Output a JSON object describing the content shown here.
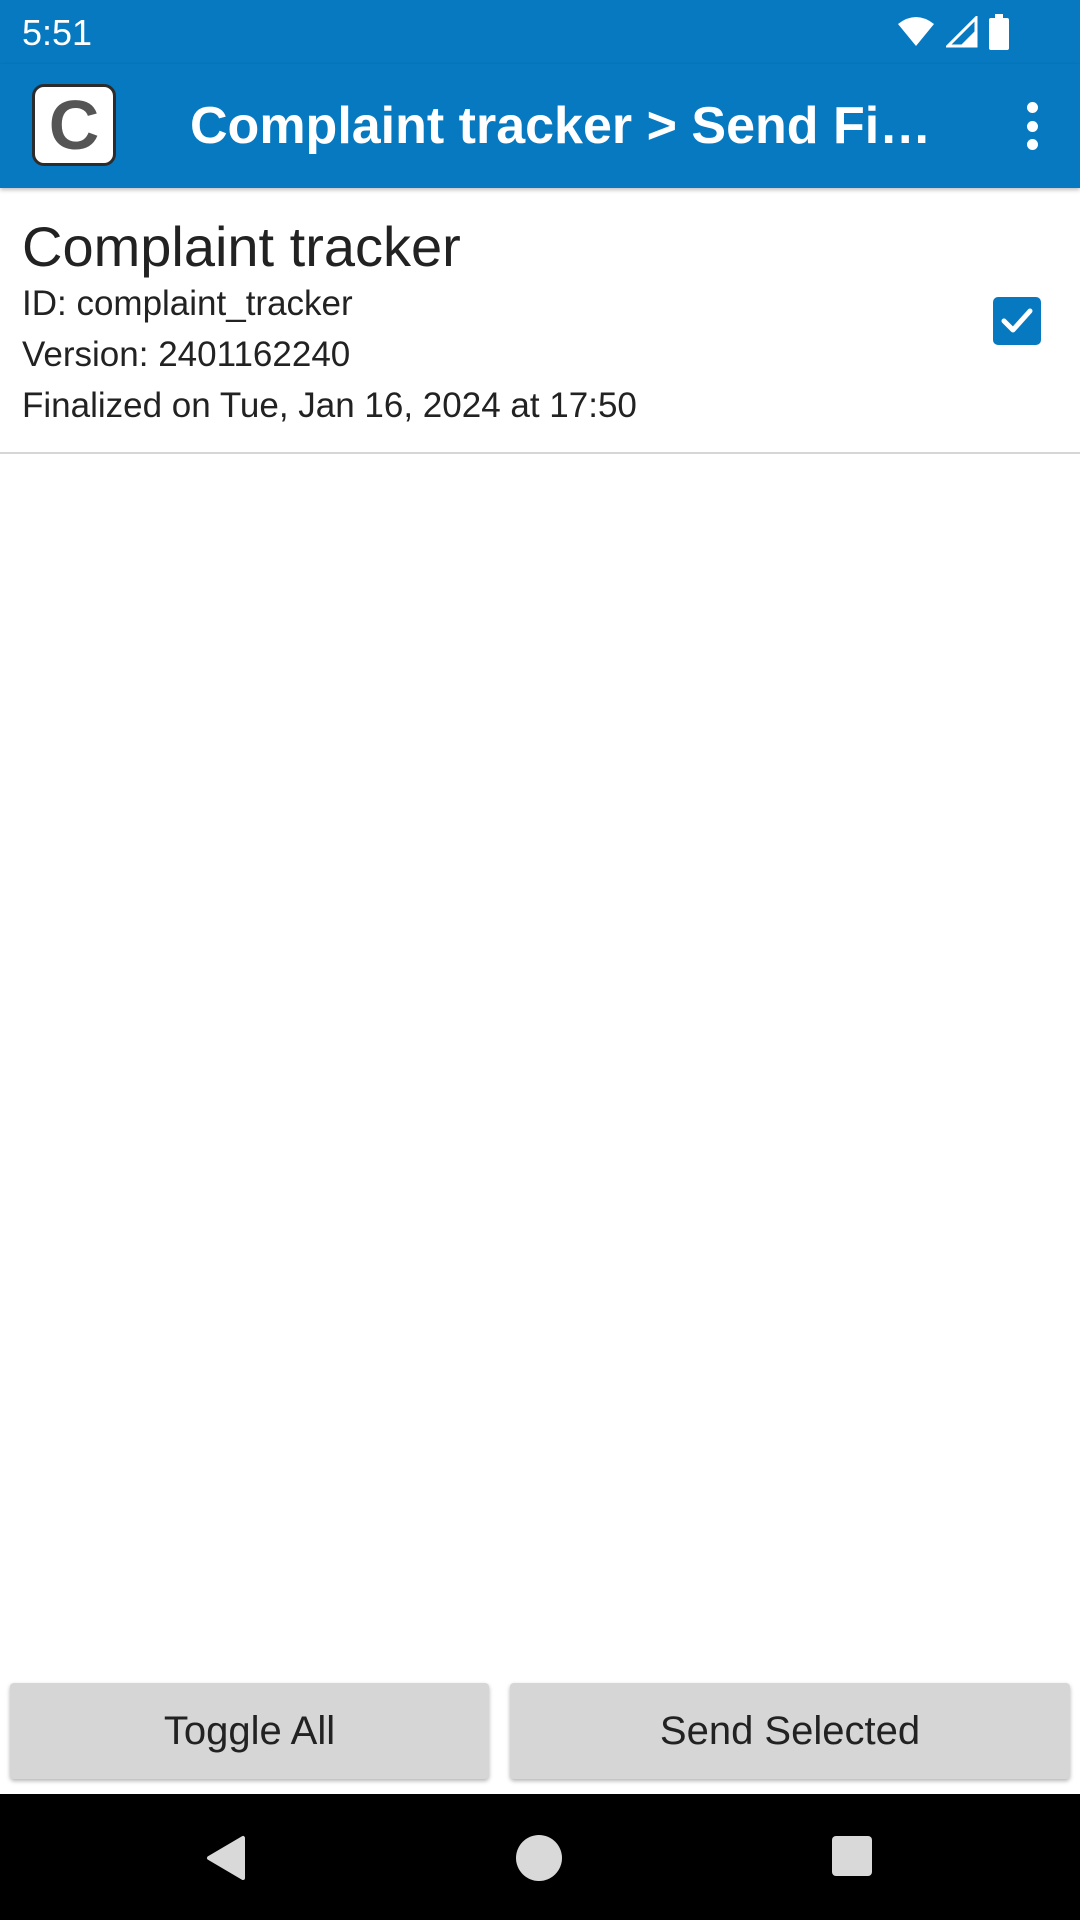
{
  "status_bar": {
    "time": "5:51",
    "icons": [
      "wifi-icon",
      "signal-icon",
      "battery-icon"
    ]
  },
  "app_bar": {
    "logo_letter": "C",
    "title": "Complaint tracker > Send Finalized Forms",
    "menu_icon": "more-vert-icon",
    "color": "#0679c1"
  },
  "list": {
    "items": [
      {
        "title": "Complaint tracker",
        "id_text": "ID: complaint_tracker",
        "version_text": "Version: 2401162240",
        "finalized_text": "Finalized on Tue, Jan 16, 2024 at 17:50",
        "checked": true
      }
    ]
  },
  "actions": {
    "toggle_all_label": "Toggle All",
    "send_selected_label": "Send Selected"
  },
  "nav_bar": {
    "icons": [
      "back-icon",
      "home-icon",
      "recents-icon"
    ]
  }
}
